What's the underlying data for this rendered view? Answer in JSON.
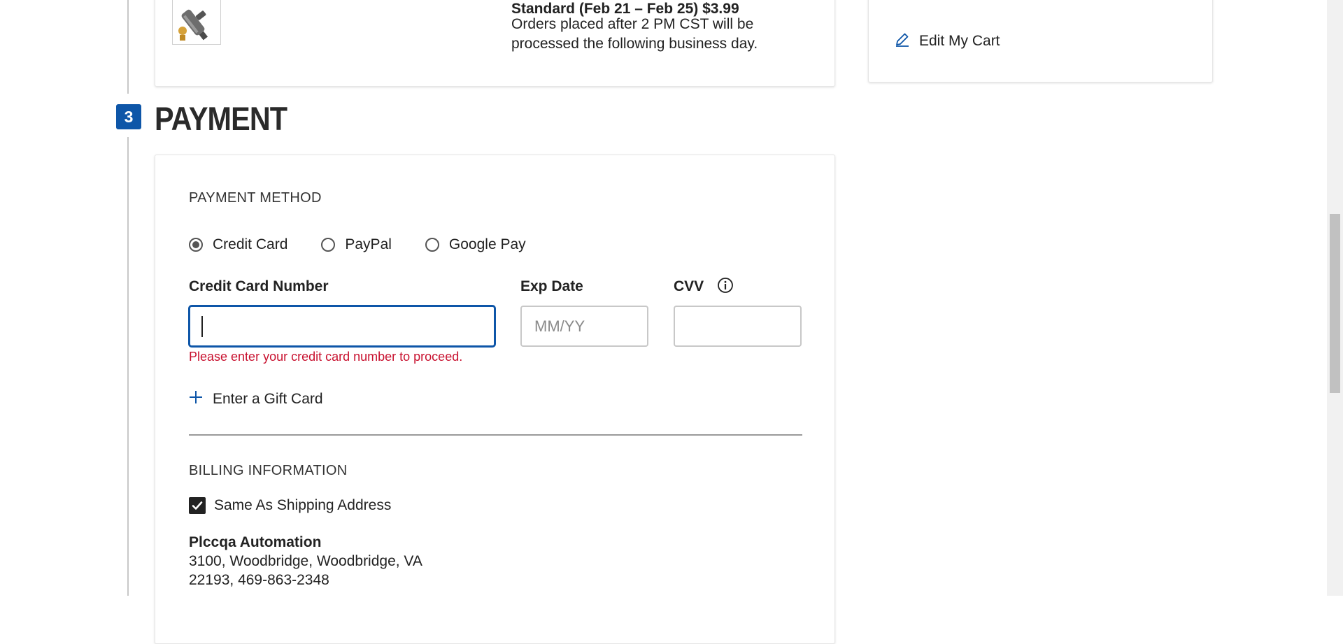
{
  "shipping": {
    "method_title": "Standard (Feb 21 – Feb 25) $3.99",
    "note": "Orders placed after 2 PM CST will be processed the following business day.",
    "product_image": "tool-part-thumbnail"
  },
  "sidebar": {
    "edit_cart_label": "Edit My Cart",
    "edit_icon": "pencil-icon"
  },
  "payment": {
    "step_number": "3",
    "title": "PAYMENT",
    "method_heading": "PAYMENT METHOD",
    "methods": [
      {
        "label": "Credit Card",
        "selected": true
      },
      {
        "label": "PayPal",
        "selected": false
      },
      {
        "label": "Google Pay",
        "selected": false
      }
    ],
    "card_number_label": "Credit Card Number",
    "card_number_value": "",
    "exp_label": "Exp Date",
    "exp_placeholder": "MM/YY",
    "cvv_label": "CVV",
    "cvv_value": "",
    "error_text": "Please enter your credit card number to proceed.",
    "gift_card_label": "Enter a Gift Card",
    "billing_heading": "BILLING INFORMATION",
    "same_as_shipping_label": "Same As Shipping Address",
    "same_as_shipping_checked": true,
    "address": {
      "name": "Plccqa Automation",
      "line1": "3100, Woodbridge, Woodbridge, VA",
      "line2": "22193, 469-863-2348"
    }
  },
  "colors": {
    "accent": "#0e56a8",
    "error": "#c8102e"
  }
}
